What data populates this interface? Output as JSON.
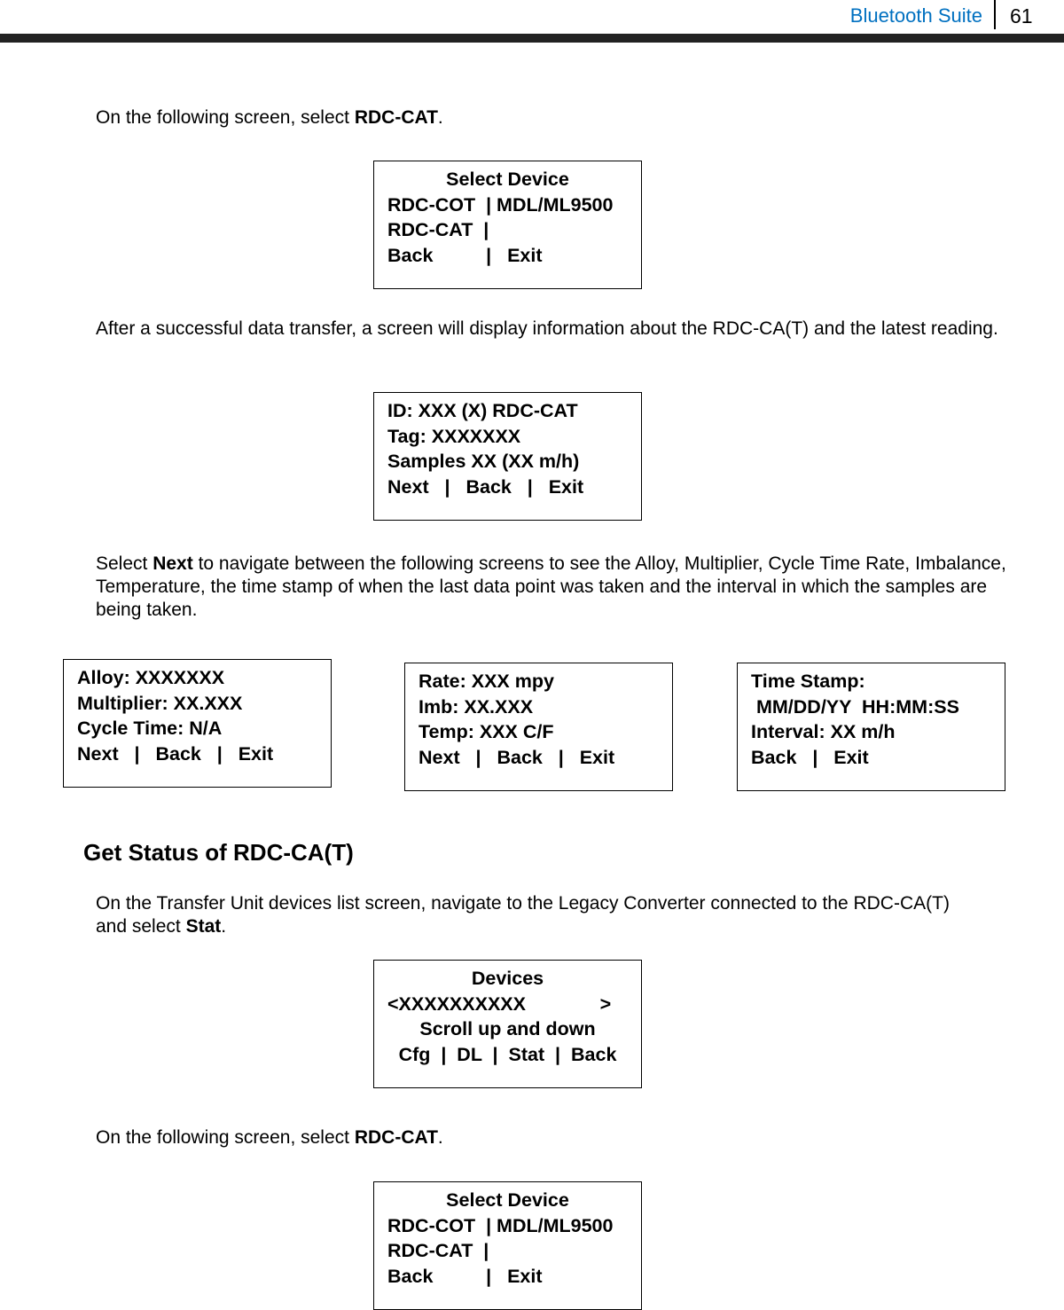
{
  "header": {
    "section": "Bluetooth Suite",
    "page": "61",
    "accent": "#0070c0"
  },
  "p1": {
    "a": "On the following screen, select ",
    "b": "RDC-CAT",
    "c": "."
  },
  "box1": [
    "Select Device",
    "RDC-COT  | MDL/ML9500",
    "RDC-CAT  |",
    "Back          |   Exit"
  ],
  "p2": "After a successful data transfer, a screen will display information about the RDC-CA(T) and the latest reading.",
  "box2": [
    "ID: XXX (X) RDC-CAT",
    "Tag: XXXXXXX",
    "Samples XX (XX m/h)",
    "Next   |   Back   |   Exit"
  ],
  "p3": {
    "a": "Select ",
    "b": "Next",
    "c": " to navigate between the following screens to see the Alloy, Multiplier, Cycle Time Rate, Imbalance, Temperature, the time stamp of when the last data point was taken and the interval in which the samples are being taken."
  },
  "box3": [
    "Alloy: XXXXXXX",
    "Multiplier: XX.XXX",
    "Cycle Time: N/A",
    "Next   |   Back   |   Exit"
  ],
  "box4": [
    "Rate: XXX mpy",
    "Imb: XX.XXX",
    "Temp: XXX C/F",
    "Next   |   Back   |   Exit"
  ],
  "box5": [
    "Time Stamp:",
    " MM/DD/YY  HH:MM:SS",
    "Interval: XX m/h",
    "Back   |   Exit"
  ],
  "heading": "Get Status of RDC-CA(T)",
  "p4": {
    "a": "On the Transfer Unit devices list screen, navigate to the Legacy Converter connected to the RDC-CA(T)  and select ",
    "b": "Stat",
    "c": "."
  },
  "box6": [
    "Devices",
    "<XXXXXXXXXX              >",
    "Scroll up and down",
    "Cfg  |  DL  |  Stat  |  Back"
  ],
  "p5": {
    "a": "On the following screen, select ",
    "b": "RDC-CAT",
    "c": "."
  },
  "box7": [
    "Select Device",
    "RDC-COT  | MDL/ML9500",
    "RDC-CAT  |",
    "Back          |   Exit"
  ]
}
